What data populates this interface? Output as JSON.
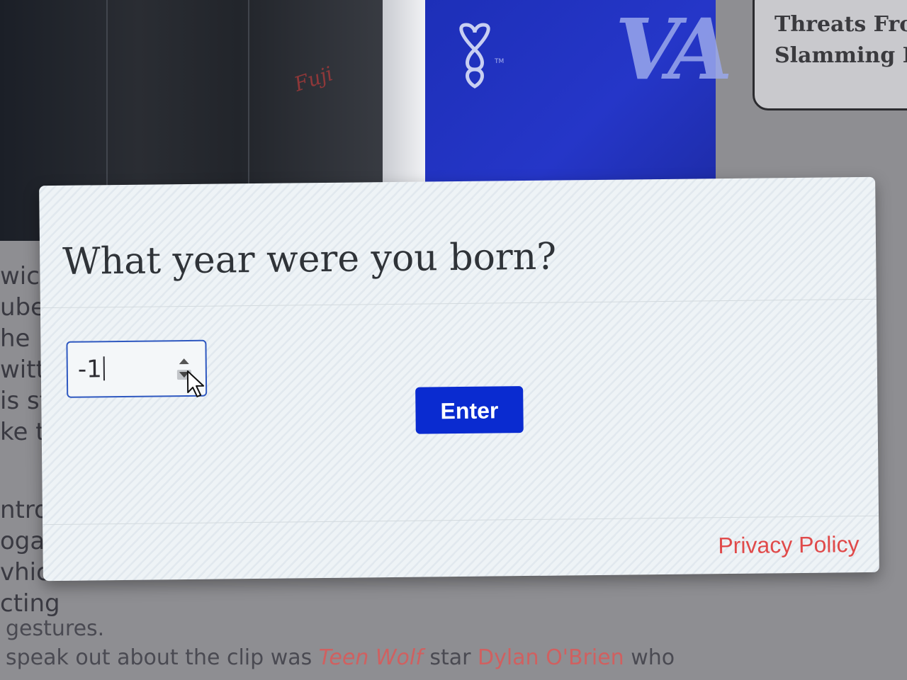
{
  "background": {
    "hero_tm": "TM",
    "hero_logo_script": "Fuji",
    "hero_letters": "VA",
    "side_card_lines": [
      "Threats From",
      "Slamming Lo"
    ],
    "article_fragments": [
      "wic",
      "ube",
      "he",
      "witt",
      "is st",
      "ke to",
      "ntrov",
      "ogar",
      "vhicl",
      "cting"
    ],
    "article_line_1": "gestures.",
    "article_line_2_pre": "speak out about the clip was ",
    "article_line_2_link1": "Teen Wolf",
    "article_line_2_mid": " star ",
    "article_line_2_link2": "Dylan O'Brien",
    "article_line_2_post": " who"
  },
  "modal": {
    "heading": "What year were you born?",
    "year_input_value": "-1",
    "enter_label": "Enter",
    "privacy_label": "Privacy Policy"
  },
  "colors": {
    "enter_button": "#0a2bd0",
    "privacy_link": "#e04a4a",
    "input_border": "#2e58c0"
  }
}
